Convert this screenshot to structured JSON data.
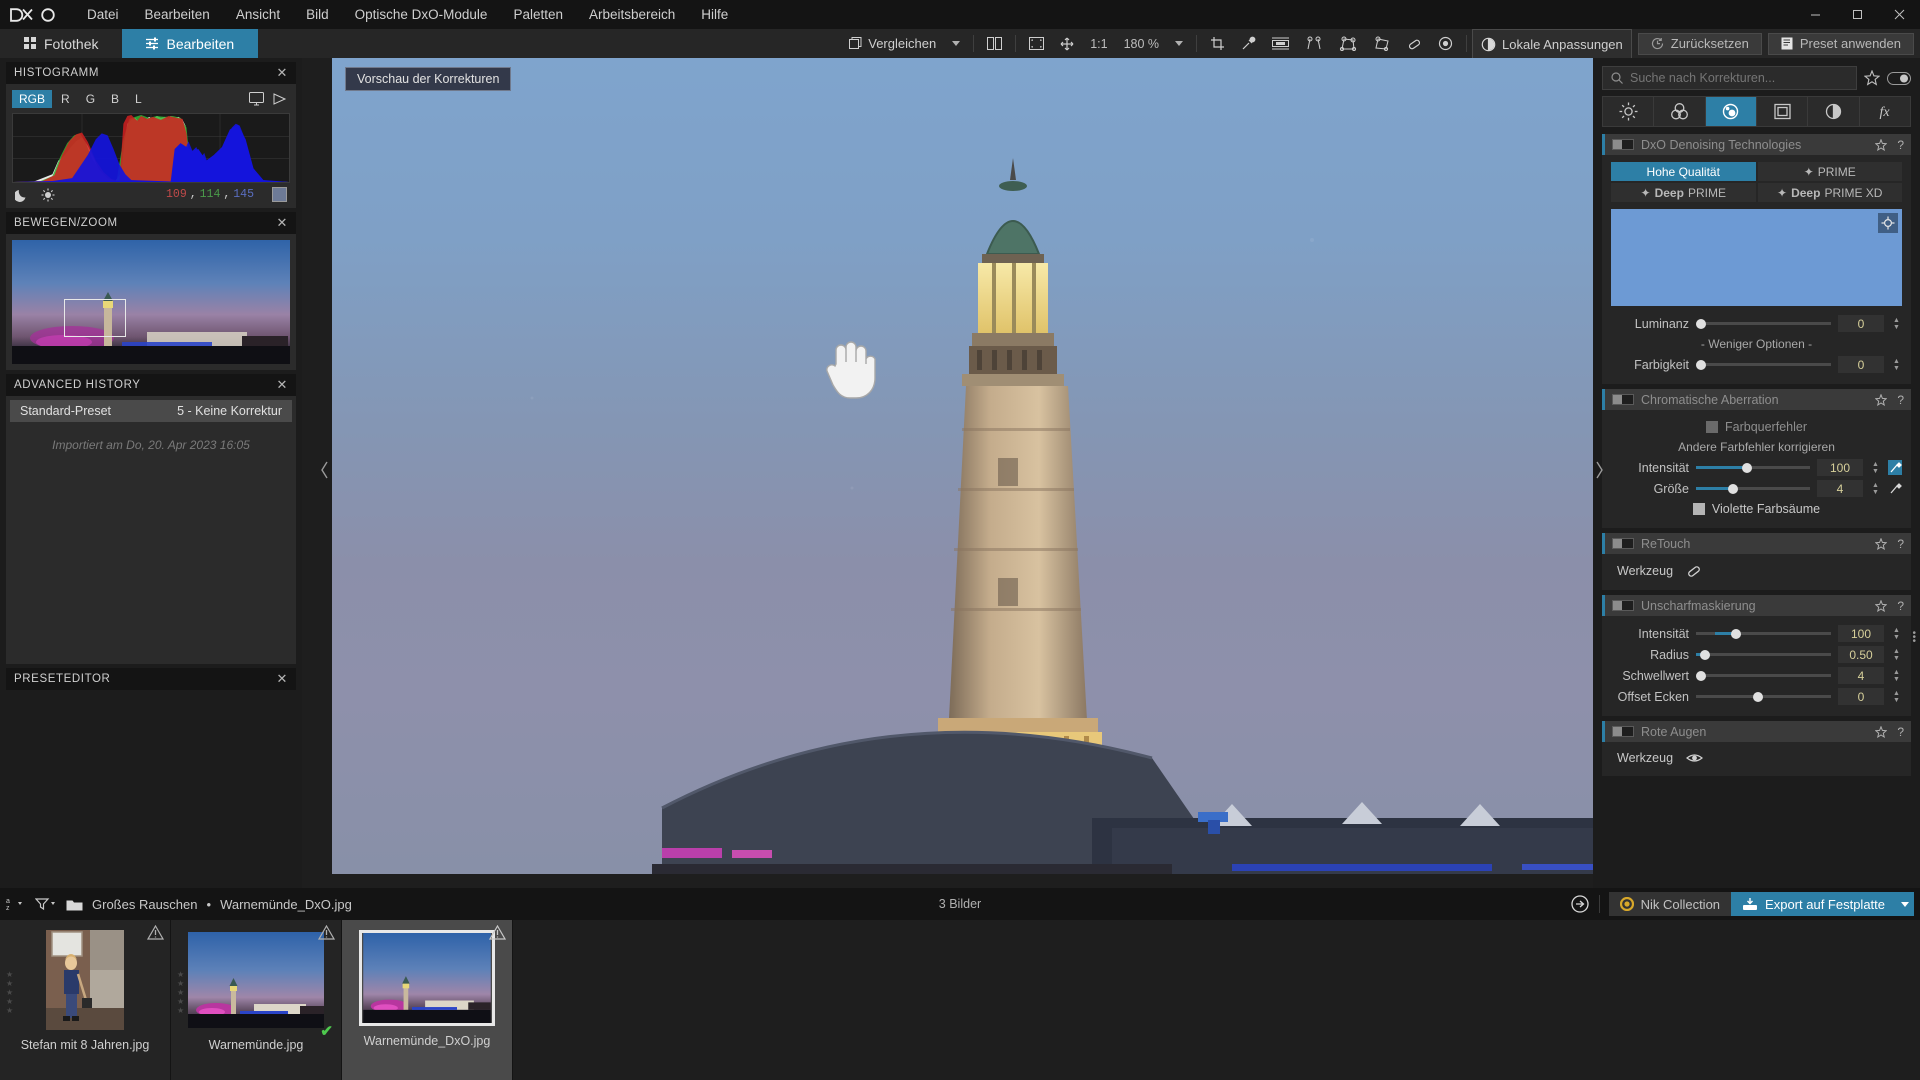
{
  "app": {
    "logo": "DXO"
  },
  "menubar": {
    "items": [
      "Datei",
      "Bearbeiten",
      "Ansicht",
      "Bild",
      "Optische DxO-Module",
      "Paletten",
      "Arbeitsbereich",
      "Hilfe"
    ],
    "window_controls": {
      "minimize": "—",
      "maximize": "❑",
      "close": "✕"
    }
  },
  "toolbar": {
    "tab_library": "Fotothek",
    "tab_edit": "Bearbeiten",
    "compare": "Vergleichen",
    "zoom_fit": "1:1",
    "zoom_level": "180 %",
    "local_adjustments": "Lokale Anpassungen",
    "reset": "Zurücksetzen",
    "apply_preset": "Preset anwenden",
    "icons": [
      "split-view-icon",
      "fit-screen-icon",
      "pan-icon",
      "crop-icon",
      "eyedropper-icon",
      "horizon-icon",
      "perspective-2points-icon",
      "perspective-4points-icon",
      "perspective-8points-icon",
      "repair-icon",
      "red-eye-icon"
    ]
  },
  "left_panel": {
    "histogram": {
      "title": "HISTOGRAMM",
      "channels": [
        "RGB",
        "R",
        "G",
        "B",
        "L"
      ],
      "selected_channel": "RGB",
      "values": {
        "r": "109",
        "g": "114",
        "b": "145"
      },
      "sep1": ",",
      "sep2": ","
    },
    "navigator": {
      "title": "BEWEGEN/ZOOM"
    },
    "history": {
      "title": "ADVANCED HISTORY",
      "row_left": "Standard-Preset",
      "row_right": "5 - Keine Korrektur",
      "note": "Importiert am Do, 20. Apr 2023 16:05"
    },
    "preseteditor": {
      "title": "PRESETEDITOR"
    },
    "close_label": "✕"
  },
  "viewer": {
    "preview_badge": "Vorschau der Korrekturen",
    "cursor": "hand-cursor"
  },
  "right_panel": {
    "search": {
      "placeholder": "Suche nach Korrekturen...",
      "value": ""
    },
    "category_tabs": [
      {
        "name": "light-icon",
        "selected": false
      },
      {
        "name": "color-icon",
        "selected": false
      },
      {
        "name": "detail-icon",
        "selected": true
      },
      {
        "name": "geometry-icon",
        "selected": false
      },
      {
        "name": "local-icon",
        "selected": false
      },
      {
        "name": "effects-icon",
        "selected": false
      }
    ],
    "sections": [
      {
        "id": "denoise",
        "title": "DxO Denoising Technologies",
        "enabled": false,
        "modes": [
          {
            "label": "Hohe Qualität",
            "selected": true,
            "star": false
          },
          {
            "label": "PRIME",
            "selected": false,
            "star": true
          },
          {
            "label": "DeepPRIME",
            "selected": false,
            "star": true,
            "bold_prefix": "Deep",
            "rest": "PRIME"
          },
          {
            "label": "DeepPRIME XD",
            "selected": false,
            "star": true,
            "bold_prefix": "Deep",
            "rest": "PRIME XD"
          }
        ],
        "less_options": "- Weniger Optionen -",
        "sliders": [
          {
            "label": "Luminanz",
            "value": "0",
            "pos": 0
          },
          {
            "label": "Farbigkeit",
            "value": "0",
            "pos": 0
          }
        ]
      },
      {
        "id": "chromatic",
        "title": "Chromatische Aberration",
        "enabled": false,
        "checkbox1": "Farbquerfehler",
        "subtitle": "Andere Farbfehler korrigieren",
        "sliders": [
          {
            "label": "Intensität",
            "value": "100",
            "pos": 42
          },
          {
            "label": "Größe",
            "value": "4",
            "pos": 30
          }
        ],
        "checkbox2": "Violette Farbsäume"
      },
      {
        "id": "retouch",
        "title": "ReTouch",
        "enabled": false,
        "tool_label": "Werkzeug",
        "tool_icon": "eraser-icon"
      },
      {
        "id": "unsharp",
        "title": "Unscharfmaskierung",
        "enabled": false,
        "sliders": [
          {
            "label": "Intensität",
            "value": "100",
            "pos": 26
          },
          {
            "label": "Radius",
            "value": "0.50",
            "pos": 6
          },
          {
            "label": "Schwellwert",
            "value": "4",
            "pos": 0
          },
          {
            "label": "Offset Ecken",
            "value": "0",
            "pos": 42
          }
        ]
      },
      {
        "id": "redeye",
        "title": "Rote Augen",
        "enabled": false,
        "tool_label": "Werkzeug",
        "tool_icon": "eye-icon"
      }
    ]
  },
  "statusbar": {
    "sort_icon": "sort-az-icon",
    "filter_icon": "filter-icon",
    "folder_icon": "folder-icon",
    "folder_name": "Großes Rauschen",
    "separator": "•",
    "file_name": "Warnemünde_DxO.jpg",
    "image_count": "3 Bilder",
    "export_arrow_icon": "export-arrow-icon",
    "nik_collection": "Nik Collection",
    "export_label": "Export auf Festplatte",
    "caret": "▾"
  },
  "filmstrip": {
    "items": [
      {
        "name": "Stefan mit 8 Jahren.jpg",
        "selected": false,
        "processed": false,
        "thumb": "boy-with-shovel"
      },
      {
        "name": "Warnemünde.jpg",
        "selected": false,
        "processed": true,
        "thumb": "harbour-dusk"
      },
      {
        "name": "Warnemünde_DxO.jpg",
        "selected": true,
        "processed": false,
        "thumb": "harbour-dusk"
      }
    ]
  },
  "colors": {
    "accent": "#2d7fa6",
    "panel_bg": "#262626",
    "window_bg": "#1e1e1e",
    "value_text": "#d6cf9a"
  }
}
